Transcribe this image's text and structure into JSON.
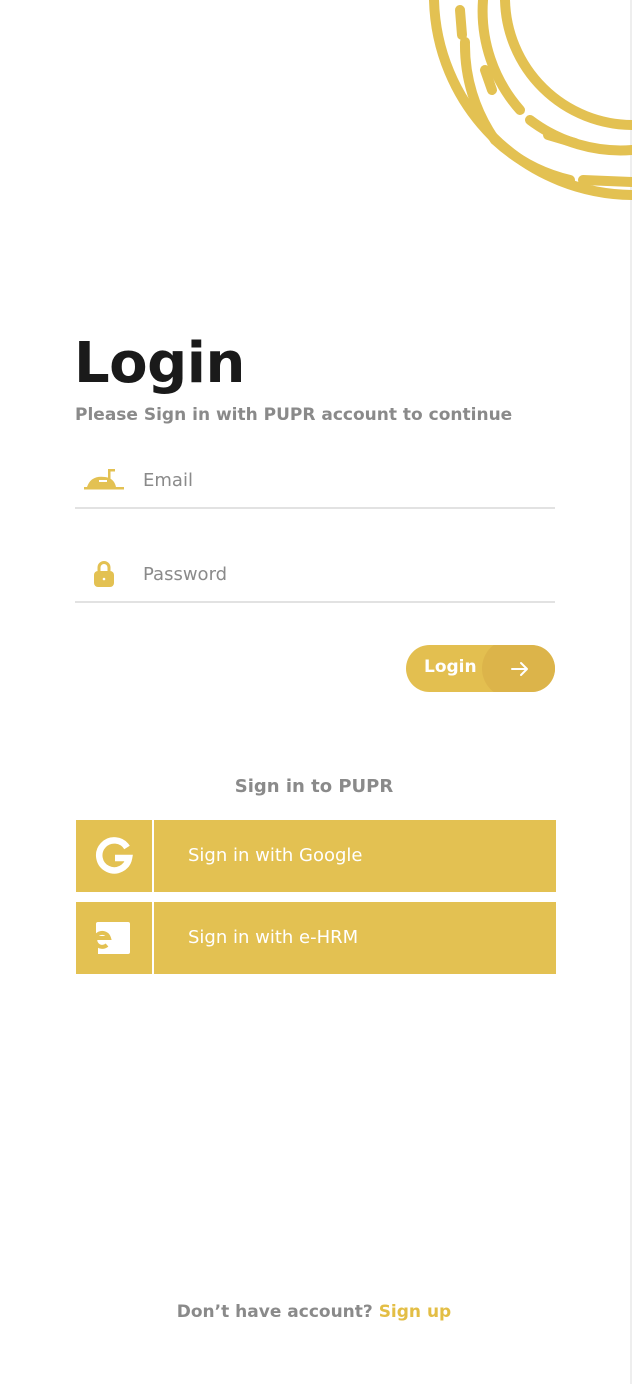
{
  "colors": {
    "accent": "#e3c152",
    "text_dark": "#1a1a1a",
    "text_muted": "#8a8a8a",
    "divider": "#e2e2e2"
  },
  "header": {
    "title": "Login",
    "subtitle": "Please Sign in with PUPR account to continue"
  },
  "form": {
    "email": {
      "icon": "mailbox-icon",
      "placeholder": "Email",
      "value": ""
    },
    "password": {
      "icon": "lock-icon",
      "placeholder": "Password",
      "value": ""
    },
    "login_button": {
      "label": "Login",
      "icon": "arrow-right-icon"
    }
  },
  "sso": {
    "heading": "Sign in to PUPR",
    "google": {
      "label": "Sign in with Google",
      "icon": "google-icon"
    },
    "ehrm": {
      "label": "Sign in with e-HRM",
      "icon": "ehrm-icon"
    }
  },
  "footer": {
    "prompt": "Don’t have account?",
    "signup_label": "Sign up"
  }
}
